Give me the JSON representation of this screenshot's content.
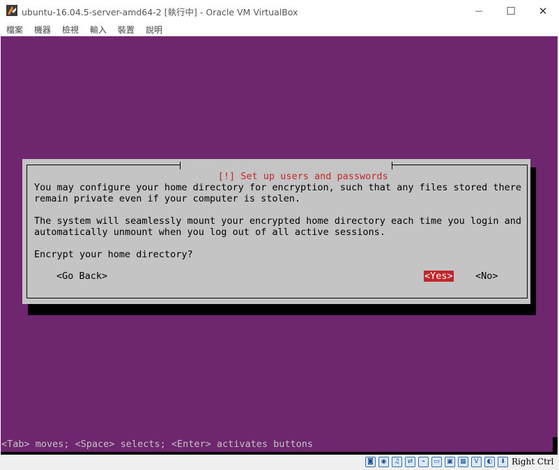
{
  "window": {
    "title": "ubuntu-16.04.5-server-amd64-2 [執行中] - Oracle VM VirtualBox",
    "minimize_glyph": "—",
    "maximize_glyph": "☐",
    "close_glyph": "✕",
    "icon": "virtualbox-icon"
  },
  "menu": {
    "items": [
      {
        "label": "檔案"
      },
      {
        "label": "機器"
      },
      {
        "label": "檢視"
      },
      {
        "label": "輸入"
      },
      {
        "label": "裝置"
      },
      {
        "label": "說明"
      }
    ]
  },
  "dialog": {
    "title": "[!] Set up users and passwords",
    "lines": [
      "You may configure your home directory for encryption, such that any files stored there",
      "remain private even if your computer is stolen.",
      "The system will seamlessly mount your encrypted home directory each time you login and",
      "automatically unmount when you log out of all active sessions.",
      "Encrypt your home directory?"
    ],
    "buttons": {
      "go_back": "<Go Back>",
      "yes": "<Yes>",
      "no": "<No>"
    },
    "selected_button": "yes"
  },
  "help_line": "<Tab> moves; <Space> selects; <Enter> activates buttons",
  "colors": {
    "vm_background": "#6e266e",
    "dialog_background": "#c4c4c4",
    "accent_red": "#c0262a"
  },
  "statusbar": {
    "icons": [
      {
        "name": "hard-disk-icon",
        "glyph": "◙"
      },
      {
        "name": "optical-drive-icon",
        "glyph": "◉"
      },
      {
        "name": "audio-icon",
        "glyph": "♫"
      },
      {
        "name": "network-icon",
        "glyph": "⇄"
      },
      {
        "name": "usb-icon",
        "glyph": "⌁"
      },
      {
        "name": "shared-folders-icon",
        "glyph": "▭"
      },
      {
        "name": "display-icon",
        "glyph": "▣"
      },
      {
        "name": "recording-icon",
        "glyph": "▦"
      },
      {
        "name": "cpu-icon",
        "glyph": "V"
      },
      {
        "name": "mouse-integration-icon",
        "glyph": "◐"
      },
      {
        "name": "keyboard-capture-icon",
        "glyph": "⬇"
      }
    ],
    "host_key": "Right Ctrl"
  }
}
